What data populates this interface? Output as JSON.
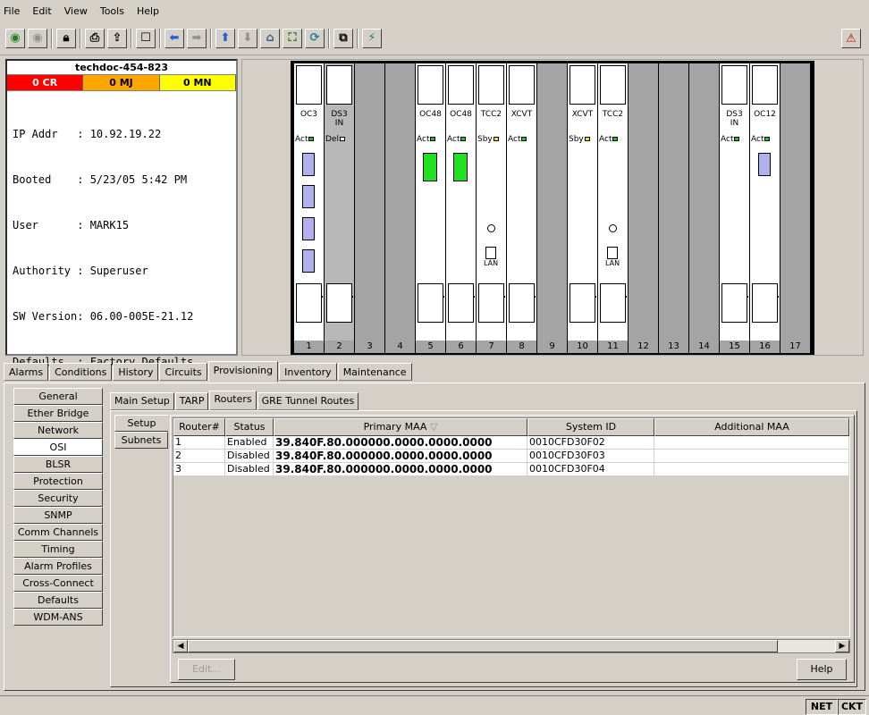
{
  "menu": [
    "File",
    "Edit",
    "View",
    "Tools",
    "Help"
  ],
  "node": {
    "name": "techdoc-454-823",
    "alarms": [
      {
        "label": "0 CR",
        "color": "#ff0000",
        "text_color": "#ffffff"
      },
      {
        "label": "0 MJ",
        "color": "#ffa500",
        "text_color": "#000000"
      },
      {
        "label": "0 MN",
        "color": "#ffff00",
        "text_color": "#000000"
      }
    ],
    "info": [
      "IP Addr   : 10.92.19.22",
      "Booted    : 5/23/05 5:42 PM",
      "User      : MARK15",
      "Authority : Superuser",
      "SW Version: 06.00-005E-21.12",
      "Defaults  : Factory Defaults"
    ]
  },
  "shelf": {
    "slots": [
      {
        "num": "1",
        "label": "OC3",
        "status": "Act",
        "led": "#20c020",
        "card": true,
        "ports": 4,
        "port_color": "blue"
      },
      {
        "num": "2",
        "label": "DS3\nIN",
        "status": "Del",
        "led": "#ffffff",
        "card": true,
        "grey": true
      },
      {
        "num": "3"
      },
      {
        "num": "4"
      },
      {
        "num": "5",
        "label": "OC48",
        "status": "Act",
        "led": "#20c020",
        "card": true,
        "ports": 1,
        "port_color": "green"
      },
      {
        "num": "6",
        "label": "OC48",
        "status": "Act",
        "led": "#20c020",
        "card": true,
        "ports": 1,
        "port_color": "green"
      },
      {
        "num": "7",
        "label": "TCC2",
        "status": "Sby",
        "led": "#ffd700",
        "card": true,
        "lan": "LAN"
      },
      {
        "num": "8",
        "label": "XCVT",
        "status": "Act",
        "led": "#20c020",
        "card": true
      },
      {
        "num": "9"
      },
      {
        "num": "10",
        "label": "XCVT",
        "status": "Sby",
        "led": "#ffd700",
        "card": true
      },
      {
        "num": "11",
        "label": "TCC2",
        "status": "Act",
        "led": "#20c020",
        "card": true,
        "lan": "LAN"
      },
      {
        "num": "12"
      },
      {
        "num": "13"
      },
      {
        "num": "14"
      },
      {
        "num": "15",
        "label": "DS3\nIN",
        "status": "Act",
        "led": "#20c020",
        "card": true
      },
      {
        "num": "16",
        "label": "OC12",
        "status": "Act",
        "led": "#20c020",
        "card": true,
        "ports": 1,
        "port_color": "blue"
      },
      {
        "num": "17"
      }
    ]
  },
  "main_tabs": [
    "Alarms",
    "Conditions",
    "History",
    "Circuits",
    "Provisioning",
    "Inventory",
    "Maintenance"
  ],
  "side_tabs": [
    "General",
    "Ether Bridge",
    "Network",
    "OSI",
    "BLSR",
    "Protection",
    "Security",
    "SNMP",
    "Comm Channels",
    "Timing",
    "Alarm Profiles",
    "Cross-Connect",
    "Defaults",
    "WDM-ANS"
  ],
  "sub_tabs": [
    "Main Setup",
    "TARP",
    "Routers",
    "GRE Tunnel Routes"
  ],
  "inner_tabs": [
    "Setup",
    "Subnets"
  ],
  "table": {
    "columns": [
      "Router#",
      "Status",
      "Primary MAA",
      "System ID",
      "Additional MAA"
    ],
    "rows": [
      [
        "1",
        "Enabled",
        "39.840F.80.000000.0000.0000.0000",
        "0010CFD30F02",
        ""
      ],
      [
        "2",
        "Disabled",
        "39.840F.80.000000.0000.0000.0000",
        "0010CFD30F03",
        ""
      ],
      [
        "3",
        "Disabled",
        "39.840F.80.000000.0000.0000.0000",
        "0010CFD30F04",
        ""
      ]
    ]
  },
  "buttons": {
    "edit": "Edit...",
    "help": "Help"
  },
  "status": {
    "net": "NET",
    "ckt": "CKT"
  }
}
